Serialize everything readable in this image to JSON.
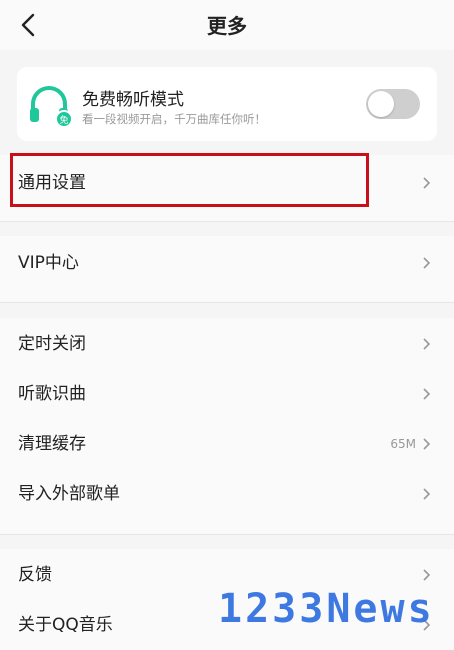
{
  "header": {
    "title": "更多"
  },
  "free_mode": {
    "title": "免费畅听模式",
    "subtitle": "看一段视频开启，千万曲库任你听！",
    "badge": "免",
    "accent_color": "#1fc79a",
    "enabled": false
  },
  "sections": [
    {
      "items": [
        {
          "label": "通用设置"
        }
      ]
    },
    {
      "items": [
        {
          "label": "VIP中心"
        }
      ]
    },
    {
      "items": [
        {
          "label": "定时关闭"
        },
        {
          "label": "听歌识曲"
        },
        {
          "label": "清理缓存",
          "value": "65M"
        },
        {
          "label": "导入外部歌单"
        }
      ]
    },
    {
      "items": [
        {
          "label": "反馈"
        },
        {
          "label": "关于QQ音乐"
        }
      ]
    }
  ],
  "highlight_color": "#c8101a",
  "watermark": "1233News"
}
